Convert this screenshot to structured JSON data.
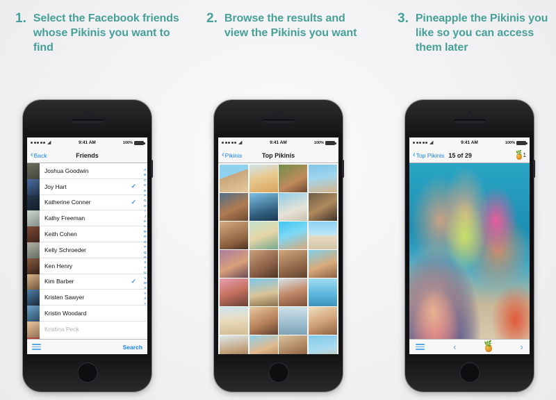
{
  "theme": {
    "accent_teal": "#46a098",
    "ios_blue": "#1783f2",
    "background": "#f2f2f4"
  },
  "steps": [
    {
      "number": "1.",
      "text": "Select the Facebook friends whose Pikinis you want to find"
    },
    {
      "number": "2.",
      "text": "Browse the results and view the Pikinis you want"
    },
    {
      "number": "3.",
      "text": "Pineapple the Pikinis you like so you can access them later"
    }
  ],
  "status_bar": {
    "signal_dots": 5,
    "wifi_icon": "wifi-icon",
    "time": "9:41 AM",
    "battery_percent": "100%",
    "battery_icon": "battery-full-icon"
  },
  "phone1": {
    "nav": {
      "back_label": "Back",
      "back_icon": "chevron-left-icon",
      "title": "Friends"
    },
    "friends": [
      {
        "name": "Joshua Goodwin",
        "selected": false
      },
      {
        "name": "Joy Hart",
        "selected": true
      },
      {
        "name": "Katherine Conner",
        "selected": true
      },
      {
        "name": "Kathy Freeman",
        "selected": false
      },
      {
        "name": "Keith Cohen",
        "selected": false
      },
      {
        "name": "Kelly Schroeder",
        "selected": false
      },
      {
        "name": "Ken Henry",
        "selected": false
      },
      {
        "name": "Kim Barber",
        "selected": true
      },
      {
        "name": "Kristen Sawyer",
        "selected": false
      },
      {
        "name": "Kristin Woodard",
        "selected": false
      },
      {
        "name": "Kristina Peck",
        "selected": false
      }
    ],
    "check_glyph": "✓",
    "alpha_index": [
      "A",
      "B",
      "C",
      "D",
      "E",
      "F",
      "G",
      "H",
      "I",
      "J",
      "K",
      "L",
      "M",
      "N",
      "O",
      "P",
      "Q",
      "R",
      "S",
      "T",
      "U",
      "V",
      "W",
      "X",
      "Y",
      "Z",
      "#"
    ],
    "toolbar": {
      "menu_icon": "hamburger-menu-icon",
      "search_label": "Search"
    }
  },
  "phone2": {
    "nav": {
      "back_label": "Pikinis",
      "back_icon": "chevron-left-icon",
      "title": "Top Pikinis"
    },
    "grid": {
      "columns": 4,
      "visible_rows": 7,
      "tiles": [
        "beach-man-blue-shorts",
        "yellow-bikini-woman",
        "couple-piggyback-smiling",
        "two-men-ocean",
        "group-friends-beach",
        "woman-black-bikini-boat",
        "couple-dancing-white",
        "couple-hug-sunglasses",
        "woman-black-bikini-pose",
        "blonde-woman-drink-pool",
        "woman-pink-bikini-hands-up",
        "distant-beach-shore",
        "group-pool-party",
        "friends-sunglasses-drinks",
        "couple-embrace-sand",
        "woman-sunglasses-teal-top",
        "two-women-pink-bikinis",
        "woman-lounge-chair",
        "woman-walking-shore",
        "woman-ocean-wading",
        "group-walking-beach",
        "two-women-selfie-hats",
        "surfer-in-water",
        "blonde-woman-green-bikini",
        "group-sitting-sand",
        "women-jumping-beach",
        "couple-beach-sunset",
        "woman-beach-blue-sky"
      ]
    }
  },
  "phone3": {
    "nav": {
      "back_label": "Top Pikinis",
      "back_icon": "chevron-left-icon",
      "title": "15 of 29",
      "pineapple_icon": "pineapple-icon",
      "pineapple_count": "1"
    },
    "photo": "pool-party-group-cocktails",
    "toolbar": {
      "menu_icon": "hamburger-menu-icon",
      "prev_icon": "chevron-left-icon",
      "pineapple_icon": "pineapple-icon",
      "next_icon": "chevron-right-icon"
    }
  }
}
